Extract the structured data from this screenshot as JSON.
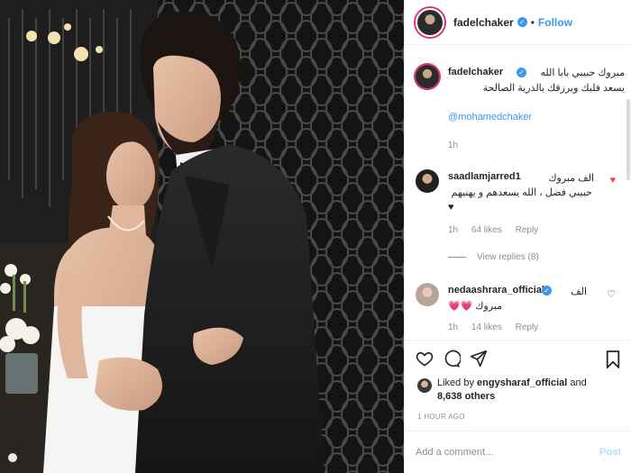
{
  "header": {
    "username": "fadelchaker",
    "dot": "•",
    "follow": "Follow"
  },
  "caption": {
    "username": "fadelchaker",
    "text_line1": "مبروك حبيبي بابا الله",
    "text_line2": "يسعد قلبك ويرزقك بالذرية الصالحة",
    "mention": "@mohamedchaker",
    "time": "1h"
  },
  "comments": [
    {
      "username": "saadlamjarred1",
      "text_line1": "الف مبروك",
      "text_line2": "حبيبي فضل ، الله يسعدهم و يهنيهم",
      "text_line3": "♥",
      "time": "1h",
      "likes": "64 likes",
      "reply": "Reply",
      "heart_color": "#ed4956",
      "view_replies": "View replies (8)"
    },
    {
      "username": "nedaashrara_official",
      "text_line1": "الف",
      "text_line2": "مبروك",
      "emoji": "💗💗",
      "time": "1h",
      "likes": "14 likes",
      "reply": "Reply"
    }
  ],
  "liked": {
    "prefix": "Liked by",
    "user": "engysharaf_official",
    "and": "and",
    "others": "8,638 others"
  },
  "timestamp": "1 HOUR AGO",
  "add_comment": {
    "placeholder": "Add a comment...",
    "post": "Post"
  },
  "colors": {
    "link": "#3897f0",
    "muted": "#8e8e8e",
    "liked_heart": "#ed4956"
  }
}
